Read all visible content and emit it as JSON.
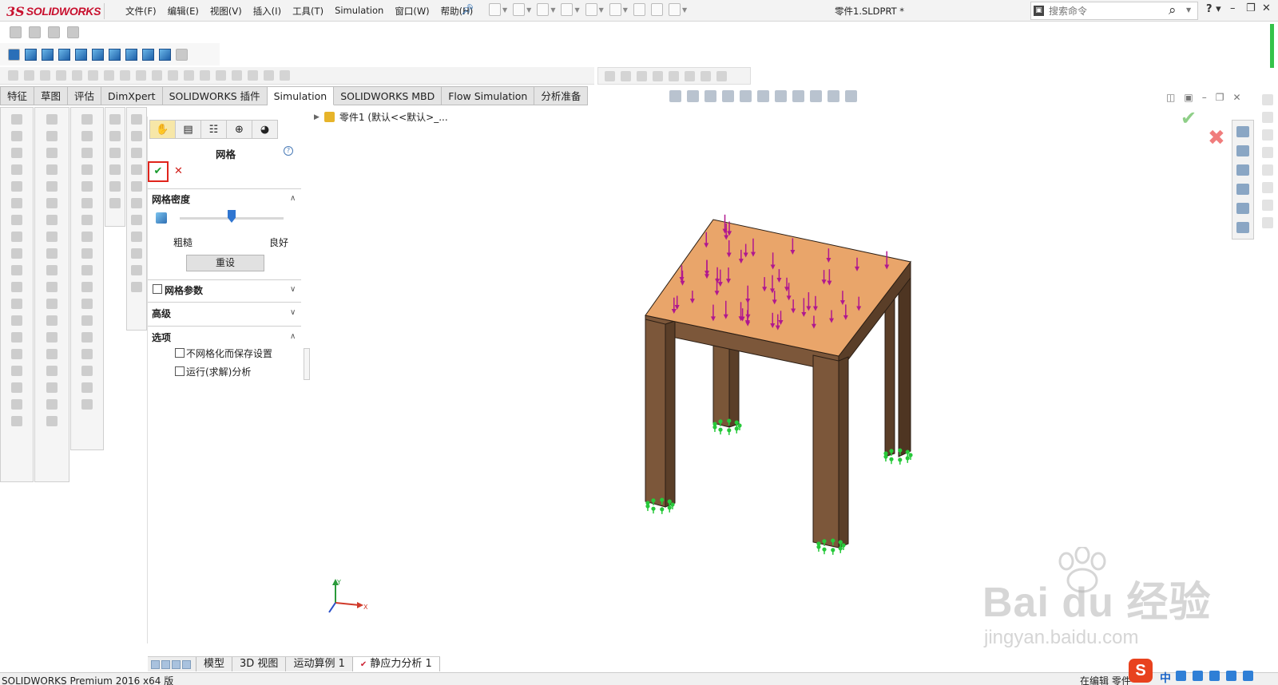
{
  "app": {
    "logo_ds": "3S",
    "logo_name": "SOLIDWORKS",
    "doc_title": "零件1.SLDPRT *"
  },
  "menu": [
    "文件(F)",
    "编辑(E)",
    "视图(V)",
    "插入(I)",
    "工具(T)",
    "Simulation",
    "窗口(W)",
    "帮助(H)"
  ],
  "search": {
    "placeholder": "搜索命令"
  },
  "command_tabs": [
    {
      "label": "特征",
      "active": false
    },
    {
      "label": "草图",
      "active": false
    },
    {
      "label": "评估",
      "active": false
    },
    {
      "label": "DimXpert",
      "active": false
    },
    {
      "label": "SOLIDWORKS 插件",
      "active": false
    },
    {
      "label": "Simulation",
      "active": true
    },
    {
      "label": "SOLIDWORKS MBD",
      "active": false
    },
    {
      "label": "Flow Simulation",
      "active": false
    },
    {
      "label": "分析准备",
      "active": false
    }
  ],
  "property_manager": {
    "title": "网格",
    "ok_symbol": "✔",
    "cancel_symbol": "✕",
    "sections": {
      "density": "网格密度",
      "params": "网格参数",
      "advanced": "高级",
      "options": "选项"
    },
    "slider": {
      "coarse_label": "粗糙",
      "fine_label": "良好",
      "value": 0.5
    },
    "reset_label": "重设",
    "options": [
      {
        "label": "不网格化而保存设置",
        "checked": false
      },
      {
        "label": "运行(求解)分析",
        "checked": false
      }
    ],
    "params_checked": false
  },
  "tree": {
    "node": "零件1  (默认<<默认>_..."
  },
  "triad": {
    "x": "X",
    "y": "Y"
  },
  "bottom_tabs": [
    {
      "label": "模型",
      "active": false
    },
    {
      "label": "3D 视图",
      "active": false
    },
    {
      "label": "运动算例 1",
      "active": false
    },
    {
      "label": "静应力分析 1",
      "active": true
    }
  ],
  "status": {
    "left": "SOLIDWORKS Premium 2016 x64 版",
    "right": "在编辑 零件"
  },
  "watermark": {
    "main": "Bai du 经验",
    "sub": "jingyan.baidu.com"
  },
  "ime": {
    "logo": "S",
    "lang": "中"
  },
  "colors": {
    "accent_red": "#c8102e",
    "ok_green": "#1a9b2e",
    "load_arrow": "#b0188f",
    "fixture": "#27c93a",
    "wood_top": "#e9a56a",
    "wood_leg": "#7a5638"
  }
}
